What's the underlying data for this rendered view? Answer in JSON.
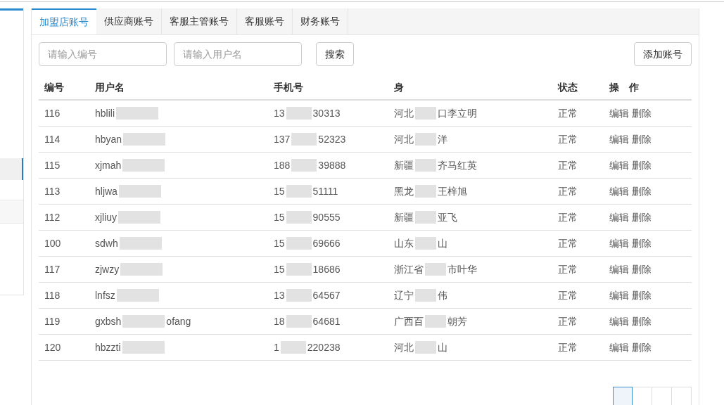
{
  "tabs": [
    {
      "label": "加盟店账号",
      "selected": true
    },
    {
      "label": "供应商账号",
      "selected": false
    },
    {
      "label": "客服主管账号",
      "selected": false
    },
    {
      "label": "客服账号",
      "selected": false
    },
    {
      "label": "财务账号",
      "selected": false
    }
  ],
  "filters": [
    {
      "placeholder": "请输入编号"
    },
    {
      "placeholder": "请输入用户名"
    }
  ],
  "search_button": "搜索",
  "add_button": "添加账号",
  "table": {
    "columns": [
      "编号",
      "用户名",
      "手机号",
      "身",
      "状态",
      "操　作"
    ],
    "rows": [
      {
        "id": "116",
        "username": {
          "head": "hblili"
        },
        "phone": {
          "head": "13",
          "tail": "30313"
        },
        "identity": {
          "head": "河北",
          "tail": "口李立明"
        },
        "status": "正常",
        "actions": [
          "编辑",
          "删除"
        ]
      },
      {
        "id": "114",
        "username": {
          "head": "hbyan"
        },
        "phone": {
          "head": "137",
          "tail": "52323"
        },
        "identity": {
          "head": "河北",
          "tail": "洋"
        },
        "status": "正常",
        "actions": [
          "编辑",
          "删除"
        ]
      },
      {
        "id": "115",
        "username": {
          "head": "xjmah"
        },
        "phone": {
          "head": "188",
          "tail": "39888"
        },
        "identity": {
          "head": "新疆",
          "tail": "齐马红英"
        },
        "status": "正常",
        "actions": [
          "编辑",
          "删除"
        ]
      },
      {
        "id": "113",
        "username": {
          "head": "hljwa"
        },
        "phone": {
          "head": "15",
          "tail": "51111"
        },
        "identity": {
          "head": "黑龙",
          "tail": "王梓旭"
        },
        "status": "正常",
        "actions": [
          "编辑",
          "删除"
        ]
      },
      {
        "id": "112",
        "username": {
          "head": "xjliuy"
        },
        "phone": {
          "head": "15",
          "tail": "90555"
        },
        "identity": {
          "head": "新疆",
          "tail": "亚飞"
        },
        "status": "正常",
        "actions": [
          "编辑",
          "删除"
        ]
      },
      {
        "id": "100",
        "username": {
          "head": "sdwh"
        },
        "phone": {
          "head": "15",
          "tail": "69666"
        },
        "identity": {
          "head": "山东",
          "tail": "山"
        },
        "status": "正常",
        "actions": [
          "编辑",
          "删除"
        ]
      },
      {
        "id": "117",
        "username": {
          "head": "zjwzy"
        },
        "phone": {
          "head": "15",
          "tail": "18686"
        },
        "identity": {
          "head": "浙江省",
          "tail": "市叶华"
        },
        "status": "正常",
        "actions": [
          "编辑",
          "删除"
        ]
      },
      {
        "id": "118",
        "username": {
          "head": "lnfsz"
        },
        "phone": {
          "head": "13",
          "tail": "64567"
        },
        "identity": {
          "head": "辽宁",
          "tail": "伟"
        },
        "status": "正常",
        "actions": [
          "编辑",
          "删除"
        ]
      },
      {
        "id": "119",
        "username": {
          "head": "gxbsh",
          "tail": "ofang"
        },
        "phone": {
          "head": "18",
          "tail": "64681"
        },
        "identity": {
          "head": "广西百",
          "tail": "朝芳"
        },
        "status": "正常",
        "actions": [
          "编辑",
          "删除"
        ]
      },
      {
        "id": "120",
        "username": {
          "head": "hbzzti"
        },
        "phone": {
          "head": "1",
          "tail": "220238"
        },
        "identity": {
          "head": "河北",
          "tail": "山"
        },
        "status": "正常",
        "actions": [
          "编辑",
          "删除"
        ]
      }
    ]
  },
  "pagination": {
    "pages": [
      {
        "selected": true
      },
      {
        "selected": false
      },
      {
        "selected": false
      },
      {
        "selected": false
      }
    ]
  }
}
